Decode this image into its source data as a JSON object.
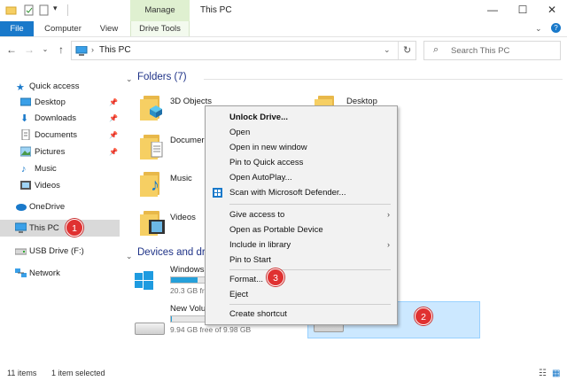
{
  "window": {
    "title": "This PC",
    "contextual_tab_group": "Manage",
    "controls": {
      "minimize": "—",
      "maximize": "☐",
      "close": "✕"
    }
  },
  "ribbon": {
    "tabs": [
      "File",
      "Computer",
      "View",
      "Drive Tools"
    ]
  },
  "address": {
    "path_root": "This PC",
    "search_placeholder": "Search This PC"
  },
  "sidebar": {
    "items": [
      {
        "label": "Quick access",
        "icon": "star-icon"
      },
      {
        "label": "Desktop",
        "icon": "desktop-icon",
        "pinned": true
      },
      {
        "label": "Downloads",
        "icon": "download-icon",
        "pinned": true
      },
      {
        "label": "Documents",
        "icon": "document-icon",
        "pinned": true
      },
      {
        "label": "Pictures",
        "icon": "picture-icon",
        "pinned": true
      },
      {
        "label": "Music",
        "icon": "music-icon"
      },
      {
        "label": "Videos",
        "icon": "video-icon"
      },
      {
        "label": "OneDrive",
        "icon": "cloud-icon"
      },
      {
        "label": "This PC",
        "icon": "computer-icon",
        "selected": true
      },
      {
        "label": "USB Drive (F:)",
        "icon": "usb-drive-icon"
      },
      {
        "label": "Network",
        "icon": "network-icon"
      }
    ]
  },
  "content": {
    "folders_header": "Folders (7)",
    "folders": [
      {
        "label": "3D Objects"
      },
      {
        "label": "Desktop"
      },
      {
        "label": "Documer"
      },
      {
        "label": "Music"
      },
      {
        "label": "Videos"
      }
    ],
    "devices_header": "Devices and dr",
    "drives": [
      {
        "name": "Windows",
        "free": "20.3 GB free",
        "fill": 0.72
      },
      {
        "name": "New Volu",
        "free": "9.94 GB free of 9.98 GB",
        "fill": 0.01
      }
    ]
  },
  "context_menu": {
    "items": [
      {
        "label": "Unlock Drive...",
        "bold": true
      },
      {
        "label": "Open"
      },
      {
        "label": "Open in new window"
      },
      {
        "label": "Pin to Quick access"
      },
      {
        "label": "Open AutoPlay..."
      },
      {
        "label": "Scan with Microsoft Defender...",
        "icon": "defender-shield-icon"
      },
      {
        "label": "Give access to",
        "submenu": true
      },
      {
        "label": "Open as Portable Device"
      },
      {
        "label": "Include in library",
        "submenu": true
      },
      {
        "label": "Pin to Start"
      },
      {
        "label": "Format..."
      },
      {
        "label": "Eject"
      },
      {
        "label": "Create shortcut"
      }
    ]
  },
  "badges": [
    "1",
    "2",
    "3"
  ],
  "status": {
    "item_count": "11 items",
    "selected_count": "1 item selected"
  },
  "colors": {
    "accent": "#1979ca",
    "manage_tab": "#dff0d0",
    "selection": "#cce8ff",
    "badge": "#e03131",
    "header_text": "#1e3287"
  }
}
